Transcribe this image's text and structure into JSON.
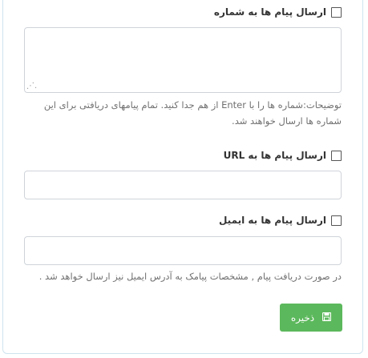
{
  "form": {
    "sms_forward_label": "ارسال پیام ها به شماره",
    "numbers_value": "",
    "numbers_help": "توضیحات:شماره ها را با Enter از هم جدا کنید. تمام پیامهای دریافتی برای این شماره ها ارسال خواهند شد.",
    "url_forward_label": "ارسال پیام ها به URL",
    "url_value": "",
    "email_forward_label": "ارسال پیام ها به ایمیل",
    "email_value": "",
    "email_help": "در صورت دریافت پیام , مشخصات پیامک به آدرس ایمیل نیز ارسال خواهد شد .",
    "save_label": "ذخیره"
  },
  "icons": {
    "save": "floppy-disk-icon",
    "resize": "resize-grip-icon"
  },
  "colors": {
    "save_button": "#5cb85c",
    "input_border": "#cfd4da",
    "help_text": "#707070"
  }
}
